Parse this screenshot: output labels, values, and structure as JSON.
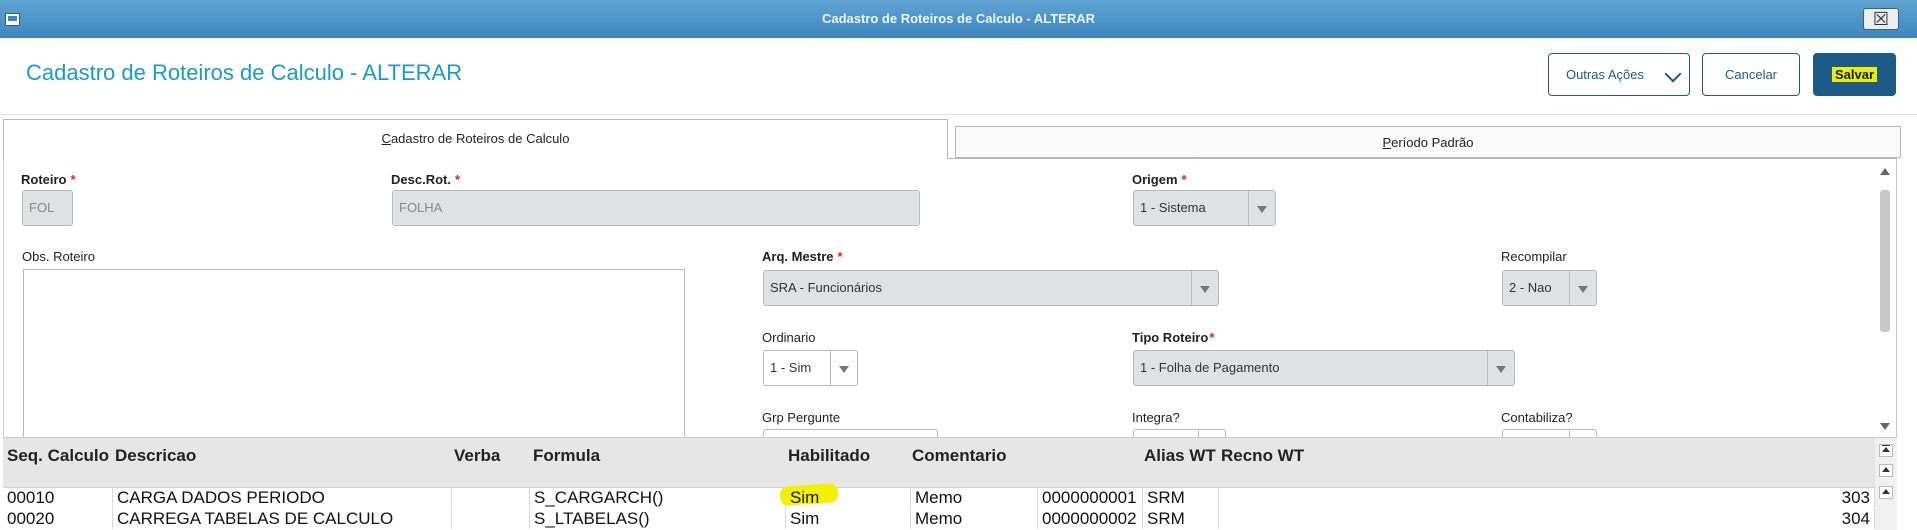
{
  "window": {
    "title": "Cadastro de Roteiros de Calculo - ALTERAR",
    "close_label": "☒"
  },
  "header": {
    "title": "Cadastro de Roteiros de Calculo - ALTERAR",
    "outras_acoes": "Outras Ações",
    "cancelar": "Cancelar",
    "salvar": "Salvar"
  },
  "tabs": [
    {
      "first": "C",
      "rest": "adastro de Roteiros de Calculo"
    },
    {
      "first": "P",
      "rest": "eríodo Padrão"
    }
  ],
  "form": {
    "roteiro": {
      "label": "Roteiro",
      "value": "FOL"
    },
    "desc_rot": {
      "label": "Desc.Rot.",
      "value": "FOLHA"
    },
    "origem": {
      "label": "Origem",
      "value": "1 - Sistema"
    },
    "obs_roteiro": {
      "label": "Obs. Roteiro"
    },
    "arq_mestre": {
      "label": "Arq. Mestre",
      "value": "SRA - Funcionários"
    },
    "recompilar": {
      "label": "Recompilar",
      "value": "2 - Nao"
    },
    "ordinario": {
      "label": "Ordinario",
      "value": "1 - Sim"
    },
    "tipo_roteiro": {
      "label": "Tipo Roteiro",
      "value": "1 - Folha de Pagamento"
    },
    "grp_pergunte": {
      "label": "Grp Pergunte"
    },
    "integra": {
      "label": "Integra?"
    },
    "contabiliza": {
      "label": "Contabiliza?"
    },
    "required_mark": "*"
  },
  "grid": {
    "columns": [
      "Seq. Calculo",
      "Descricao",
      "Verba",
      "Formula",
      "Habilitado",
      "Comentario",
      "Alias WT",
      "Recno WT"
    ],
    "rows": [
      {
        "seq": "00010",
        "descricao": "CARGA DADOS PERIODO",
        "verba": "",
        "formula": "S_CARGARCH()",
        "habilitado": "Sim",
        "comentario": "Memo",
        "id": "0000000001",
        "alias": "SRM",
        "recno": "303"
      },
      {
        "seq": "00020",
        "descricao": "CARREGA TABELAS DE CALCULO",
        "verba": "",
        "formula": "S_LTABELAS()",
        "habilitado": "Sim",
        "comentario": "Memo",
        "id": "0000000002",
        "alias": "SRM",
        "recno": "304"
      }
    ]
  }
}
